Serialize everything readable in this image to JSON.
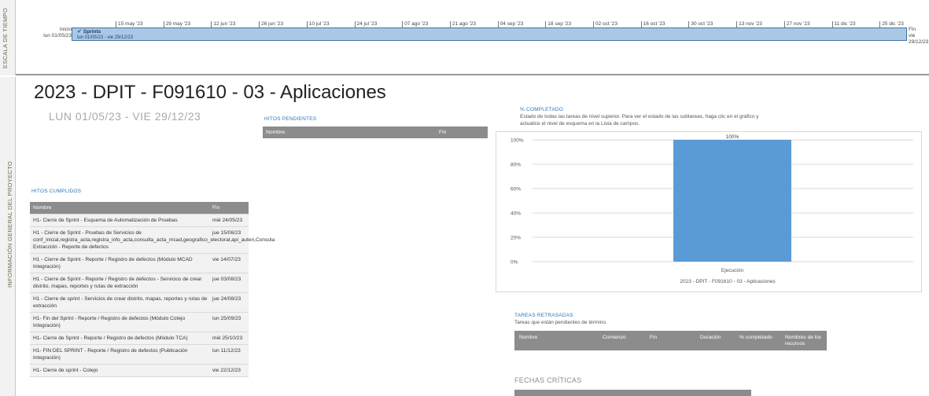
{
  "timeline": {
    "side_label": "ESCALA DE TIEMPO",
    "ticks": [
      "15 may '23",
      "29 may '23",
      "12 jun '23",
      "26 jun '23",
      "10 jul '23",
      "24 jul '23",
      "07 ago '23",
      "21 ago '23",
      "04 sep '23",
      "18 sep '23",
      "02 oct '23",
      "16 oct '23",
      "30 oct '23",
      "13 nov '23",
      "27 nov '23",
      "11 dic '23",
      "25 dic '23"
    ],
    "start_label": "Inicio",
    "start_date": "lun 01/05/23",
    "end_label": "Fin",
    "end_date": "vie 29/12/23",
    "bar_name": "Sprints",
    "bar_dates": "lun 01/05/23 - vie 29/12/23"
  },
  "report": {
    "side_label": "INFORMACIÓN GENERAL DEL PROYECTO",
    "title": "2023 - DPIT - F091610 - 03 - Aplicaciones",
    "dates": "LUN 01/05/23  -  VIE 29/12/23",
    "hitos_pendientes": {
      "title": "HITOS PENDIENTES",
      "col_name": "Nombre",
      "col_end": "Fin"
    },
    "hitos_cumplidos": {
      "title": "HITOS CUMPLIDOS",
      "col_name": "Nombre",
      "col_end": "Fin",
      "rows": [
        {
          "name": "H1- Cierre de Sprint - Esquema de Automatización de Pruebas",
          "end": "mié 24/05/23"
        },
        {
          "name": "H1 - Cierre de Sprint - Pruebas de Servicios de conf_inicial,registra_acta,registra_info_acta,consulta_acta_mcad,geografico_electoral,api_auten,Consola Extracción - Reporte de defectos",
          "end": "jue 15/06/23"
        },
        {
          "name": "H1 - Cierre de Sprint - Reporte / Registro de defectos (Módulo MCAD Integración)",
          "end": "vie 14/07/23"
        },
        {
          "name": "H1 - Cierre de Sprint - Reporte / Registro de defectos - Servicios de crear distrito, mapas, reportes y rutas de extracción",
          "end": "jue 03/08/23"
        },
        {
          "name": "H1 - Cierre de sprint - Servicios de crear distrito, mapas, reportes y rutas de extracción",
          "end": "jue 24/08/23"
        },
        {
          "name": "H1- Fin del Sprint - Reporte / Registro de defectos (Módulo Cotejo Integración)",
          "end": "lun 25/09/23"
        },
        {
          "name": "H1- Cierre de Sprint - Reporte / Registro de defectos (Módulo TCA)",
          "end": "mié 25/10/23"
        },
        {
          "name": "H1- FIN DEL SPRINT - Reporte / Registro de defectos (Publicación Integración)",
          "end": "lun 11/12/23"
        },
        {
          "name": "H1- Cierre de sprint - Cotejo",
          "end": "vie 22/12/23"
        }
      ]
    },
    "pct_completado": {
      "title": "% COMPLETADO",
      "description": "Estado de todas las tareas de nivel superior. Para ver el estado de las subtareas, haga clic en el gráfico y actualice el nivel de esquema en la Lista de campos."
    },
    "tareas_retrasadas": {
      "title": "TAREAS RETRASADAS",
      "description": "Tareas que están pendientes de término.",
      "columns": [
        "Nombre",
        "Comienzo",
        "Fin",
        "Duración",
        "% completado",
        "Nombres de los recursos"
      ]
    },
    "fechas_criticas": {
      "title": "FECHAS CRÍTICAS"
    }
  },
  "chart_data": {
    "type": "bar",
    "categories": [
      "Ejecución"
    ],
    "values": [
      100
    ],
    "data_labels": [
      "100%"
    ],
    "xlabel": "2023 - DPIT - F091610 - 03 - Aplicaciones",
    "ylabel": "",
    "ylim": [
      0,
      100
    ],
    "yticks": [
      "0%",
      "20%",
      "40%",
      "60%",
      "80%",
      "100%"
    ],
    "grid": true,
    "bar_color": "#5b9bd5"
  }
}
